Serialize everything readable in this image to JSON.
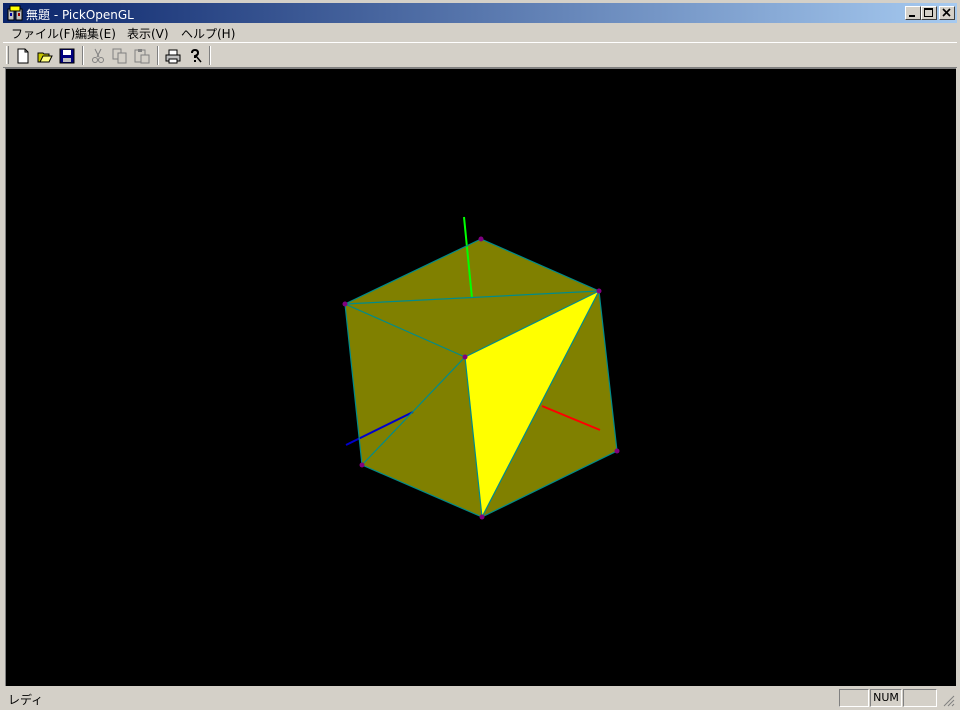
{
  "window": {
    "title": "無題 - PickOpenGL"
  },
  "menu": [
    {
      "label": "ファイル(F)"
    },
    {
      "label": "編集(E)"
    },
    {
      "label": "表示(V)"
    },
    {
      "label": "ヘルプ(H)"
    }
  ],
  "toolbar": {
    "buttons": [
      {
        "icon": "new-file-icon"
      },
      {
        "icon": "open-folder-icon"
      },
      {
        "icon": "save-disk-icon"
      },
      {
        "icon": "cut-icon",
        "disabled": true
      },
      {
        "icon": "copy-icon",
        "disabled": true
      },
      {
        "icon": "paste-icon",
        "disabled": true
      },
      {
        "icon": "print-icon"
      },
      {
        "icon": "help-icon"
      }
    ]
  },
  "scene": {
    "background": "#000000",
    "face_color": "#808000",
    "highlight_face_color": "#ffff00",
    "edge_color": "#008b8b",
    "vertex_color": "#800080",
    "axis_colors": {
      "x": "#ff0000",
      "y": "#00ff00",
      "z": "#0000cd"
    }
  },
  "status": {
    "text": "レディ",
    "indicators": [
      "",
      "NUM",
      ""
    ]
  }
}
